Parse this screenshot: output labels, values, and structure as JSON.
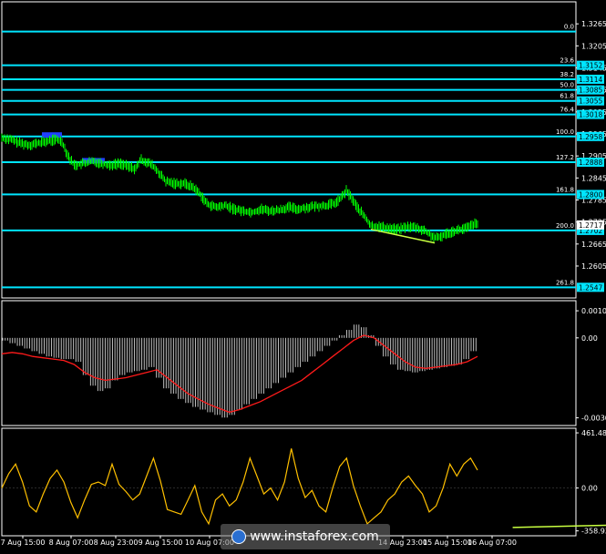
{
  "chart_data": [
    {
      "type": "line",
      "title": "",
      "ylim": [
        1.2518,
        1.3325
      ],
      "price_axis_ticks": [
        "1.3265",
        "1.3205",
        "1.3145",
        "1.3085",
        "1.3025",
        "1.2965",
        "1.2905",
        "1.2845",
        "1.2785",
        "1.2725",
        "1.2665",
        "1.2605"
      ],
      "current_price": "1.2717",
      "fib_levels": [
        {
          "label": "0.0",
          "price": 1.3244,
          "tag": ""
        },
        {
          "label": "23.6",
          "price": 1.3152,
          "tag": "1.3152"
        },
        {
          "label": "38.2",
          "price": 1.3114,
          "tag": "1.3114"
        },
        {
          "label": "50.0",
          "price": 1.3085,
          "tag": "1.3085"
        },
        {
          "label": "61.8",
          "price": 1.3055,
          "tag": "1.3055"
        },
        {
          "label": "76.4",
          "price": 1.3018,
          "tag": "1.3018"
        },
        {
          "label": "100.0",
          "price": 1.2958,
          "tag": "1.2958"
        },
        {
          "label": "127.2",
          "price": 1.2888,
          "tag": "1.2888"
        },
        {
          "label": "161.8",
          "price": 1.28,
          "tag": "1.2800"
        },
        {
          "label": "200.0",
          "price": 1.2702,
          "tag": "1.2702"
        },
        {
          "label": "261.8",
          "price": 1.2547,
          "tag": "1.2547"
        }
      ],
      "x_labels": [
        "7 Aug 15:00",
        "8 Aug 07:00",
        "8 Aug 23:00",
        "9 Aug 15:00",
        "10 Aug 07:00",
        "14 Aug 23:00",
        "15 Aug 15:00",
        "16 Aug 07:00"
      ],
      "price_path": [
        [
          0,
          1.2955
        ],
        [
          10,
          1.295
        ],
        [
          20,
          1.294
        ],
        [
          30,
          1.2935
        ],
        [
          40,
          1.294
        ],
        [
          50,
          1.2945
        ],
        [
          60,
          1.295
        ],
        [
          66,
          1.2945
        ],
        [
          70,
          1.292
        ],
        [
          75,
          1.2895
        ],
        [
          80,
          1.288
        ],
        [
          90,
          1.2885
        ],
        [
          100,
          1.289
        ],
        [
          110,
          1.2885
        ],
        [
          120,
          1.288
        ],
        [
          130,
          1.2885
        ],
        [
          140,
          1.2875
        ],
        [
          147,
          1.287
        ],
        [
          152,
          1.2895
        ],
        [
          158,
          1.289
        ],
        [
          165,
          1.288
        ],
        [
          172,
          1.286
        ],
        [
          180,
          1.2835
        ],
        [
          190,
          1.283
        ],
        [
          200,
          1.283
        ],
        [
          210,
          1.282
        ],
        [
          218,
          1.28
        ],
        [
          225,
          1.2775
        ],
        [
          235,
          1.2765
        ],
        [
          245,
          1.277
        ],
        [
          255,
          1.276
        ],
        [
          265,
          1.2755
        ],
        [
          275,
          1.2752
        ],
        [
          285,
          1.276
        ],
        [
          295,
          1.2755
        ],
        [
          305,
          1.2758
        ],
        [
          315,
          1.2765
        ],
        [
          325,
          1.276
        ],
        [
          335,
          1.2765
        ],
        [
          345,
          1.2768
        ],
        [
          355,
          1.277
        ],
        [
          365,
          1.2775
        ],
        [
          372,
          1.279
        ],
        [
          378,
          1.281
        ],
        [
          384,
          1.279
        ],
        [
          390,
          1.2765
        ],
        [
          398,
          1.274
        ],
        [
          405,
          1.2715
        ],
        [
          415,
          1.2712
        ],
        [
          425,
          1.2708
        ],
        [
          435,
          1.2705
        ],
        [
          445,
          1.2712
        ],
        [
          455,
          1.271
        ],
        [
          465,
          1.27
        ],
        [
          473,
          1.2685
        ],
        [
          478,
          1.268
        ],
        [
          485,
          1.269
        ],
        [
          495,
          1.27
        ],
        [
          505,
          1.2705
        ],
        [
          512,
          1.271
        ],
        [
          518,
          1.272
        ],
        [
          522,
          1.2717
        ]
      ],
      "trendline": [
        [
          405,
          1.2705
        ],
        [
          475,
          1.2668
        ]
      ]
    },
    {
      "type": "bar",
      "title": "",
      "axis_ticks": [
        "0.00102",
        "0.00",
        "-0.00301"
      ],
      "ylim": [
        -0.0033,
        0.0014
      ],
      "histogram": [
        -0.0001,
        -0.0002,
        -0.0003,
        -0.0004,
        -0.0005,
        -0.0006,
        -0.0007,
        -0.00075,
        -0.0008,
        -0.0008,
        -0.0009,
        -0.0014,
        -0.0018,
        -0.002,
        -0.0019,
        -0.0016,
        -0.0014,
        -0.0013,
        -0.00125,
        -0.0012,
        -0.0011,
        -0.0015,
        -0.0019,
        -0.0021,
        -0.0023,
        -0.00245,
        -0.0026,
        -0.0027,
        -0.0028,
        -0.0029,
        -0.003,
        -0.0029,
        -0.0027,
        -0.0025,
        -0.0023,
        -0.0021,
        -0.0019,
        -0.0017,
        -0.0015,
        -0.0013,
        -0.0011,
        -0.0009,
        -0.0007,
        -0.0005,
        -0.0003,
        -0.0001,
        0.0001,
        0.0003,
        0.0005,
        0.0004,
        0.0001,
        -0.0003,
        -0.0007,
        -0.001,
        -0.0012,
        -0.00125,
        -0.0013,
        -0.00125,
        -0.0012,
        -0.00115,
        -0.0011,
        -0.00105,
        -0.001,
        -0.0008,
        -0.0005
      ],
      "signal": [
        -0.0006,
        -0.00055,
        -0.0006,
        -0.0007,
        -0.00075,
        -0.0008,
        -0.00085,
        -0.001,
        -0.0013,
        -0.0015,
        -0.0016,
        -0.00155,
        -0.0015,
        -0.0014,
        -0.0013,
        -0.0012,
        -0.0015,
        -0.0018,
        -0.0021,
        -0.0023,
        -0.0025,
        -0.00265,
        -0.0028,
        -0.0027,
        -0.00255,
        -0.0024,
        -0.0022,
        -0.002,
        -0.0018,
        -0.0016,
        -0.0013,
        -0.001,
        -0.0007,
        -0.0004,
        -0.0001,
        0.0001,
        0.0,
        -0.0003,
        -0.0006,
        -0.0009,
        -0.0011,
        -0.00115,
        -0.0011,
        -0.00105,
        -0.001,
        -0.0009,
        -0.0007
      ]
    },
    {
      "type": "line",
      "title": "",
      "axis_ticks": [
        "461.4866",
        "0.00",
        "-358.938"
      ],
      "ylim": [
        -400,
        500
      ],
      "cci": [
        0,
        120,
        200,
        50,
        -150,
        -200,
        -50,
        80,
        150,
        50,
        -120,
        -250,
        -100,
        30,
        50,
        20,
        200,
        30,
        -30,
        -100,
        -50,
        100,
        250,
        60,
        -180,
        -200,
        -220,
        -100,
        20,
        -200,
        -300,
        -100,
        -50,
        -150,
        -100,
        50,
        250,
        100,
        -50,
        0,
        -100,
        50,
        330,
        80,
        -80,
        -20,
        -150,
        -200,
        0,
        180,
        250,
        20,
        -150,
        -300,
        -250,
        -200,
        -100,
        -50,
        50,
        100,
        20,
        -50,
        -200,
        -150,
        0,
        200,
        100,
        200,
        250,
        150
      ],
      "trendline_index": [
        38,
        52
      ]
    }
  ],
  "watermark": "www.instaforex.com"
}
